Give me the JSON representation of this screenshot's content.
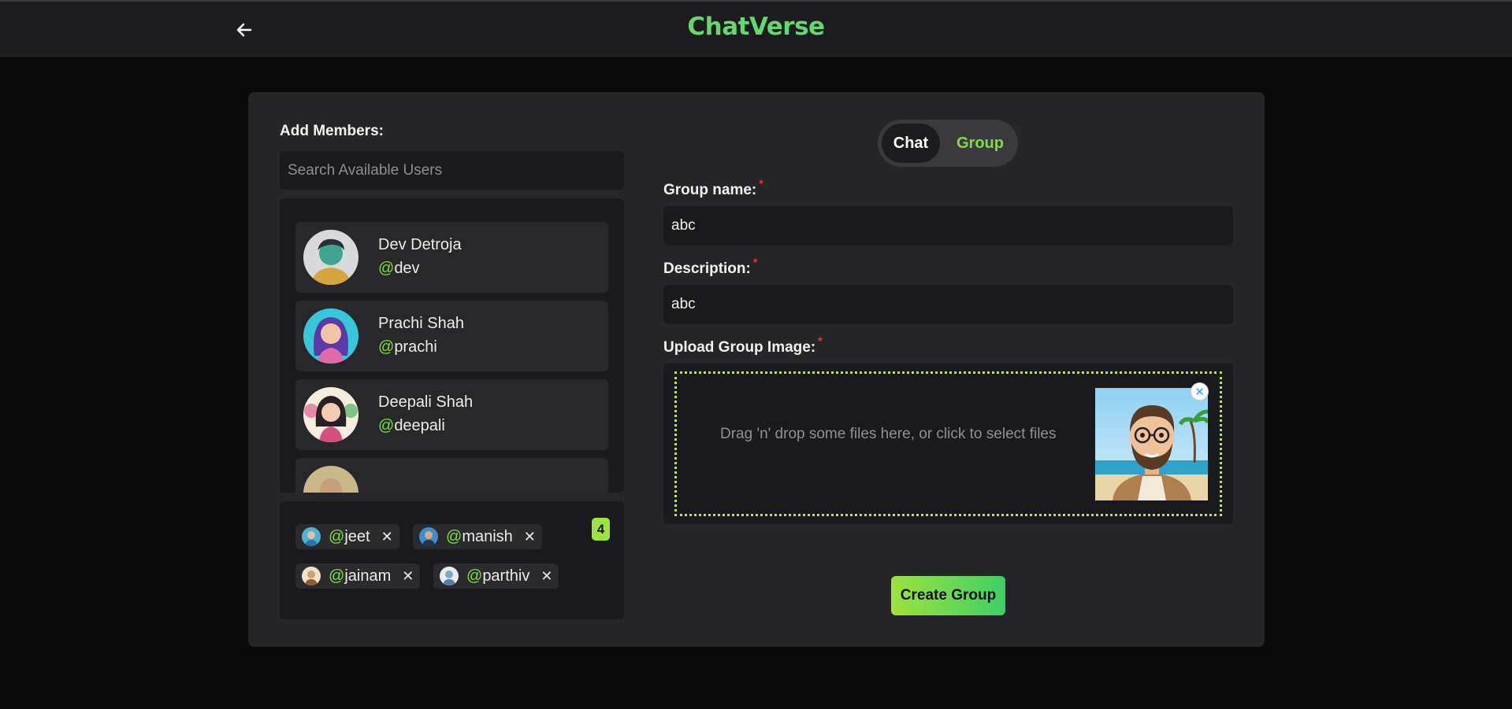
{
  "header": {
    "brand": "ChatVerse",
    "back_icon": "arrow-left-icon"
  },
  "left": {
    "add_members_label": "Add Members:",
    "search_placeholder": "Search Available Users",
    "users": [
      {
        "name": "Dev Detroja",
        "at": "@",
        "handle": "dev"
      },
      {
        "name": "Prachi Shah",
        "at": "@",
        "handle": "prachi"
      },
      {
        "name": "Deepali Shah",
        "at": "@",
        "handle": "deepali"
      }
    ],
    "selected": [
      {
        "at": "@",
        "handle": "jeet"
      },
      {
        "at": "@",
        "handle": "manish"
      },
      {
        "at": "@",
        "handle": "jainam"
      },
      {
        "at": "@",
        "handle": "parthiv"
      }
    ],
    "remove_glyph": "✕",
    "selected_count": "4"
  },
  "toggle": {
    "chat": "Chat",
    "group": "Group",
    "active": "Group"
  },
  "form": {
    "group_name_label": "Group name:",
    "group_name_value": "abc",
    "description_label": "Description:",
    "description_value": "abc",
    "upload_label": "Upload Group Image:",
    "required_mark": "*",
    "drop_text": "Drag 'n' drop some files here, or click to select files",
    "remove_image_glyph": "✕",
    "create_button": "Create Group"
  },
  "colors": {
    "accent": "#7ddc3f",
    "accent2": "#3ecf66",
    "required": "#e03b3b",
    "dropzone_border": "#b7e83a"
  }
}
